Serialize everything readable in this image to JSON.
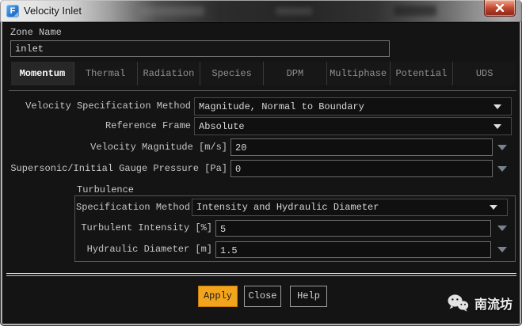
{
  "window": {
    "title": "Velocity Inlet",
    "icon_letter": "F"
  },
  "zone": {
    "label": "Zone Name",
    "value": "inlet"
  },
  "tabs": [
    {
      "label": "Momentum",
      "active": true
    },
    {
      "label": "Thermal",
      "active": false
    },
    {
      "label": "Radiation",
      "active": false
    },
    {
      "label": "Species",
      "active": false
    },
    {
      "label": "DPM",
      "active": false
    },
    {
      "label": "Multiphase",
      "active": false
    },
    {
      "label": "Potential",
      "active": false
    },
    {
      "label": "UDS",
      "active": false
    }
  ],
  "fields": {
    "velocity_spec": {
      "label": "Velocity Specification Method",
      "value": "Magnitude, Normal to Boundary"
    },
    "reference_frame": {
      "label": "Reference Frame",
      "value": "Absolute"
    },
    "velocity_magnitude": {
      "label": "Velocity Magnitude [m/s]",
      "value": "20"
    },
    "supersonic_pressure": {
      "label": "Supersonic/Initial Gauge Pressure [Pa]",
      "value": "0"
    }
  },
  "turbulence": {
    "title": "Turbulence",
    "spec_method": {
      "label": "Specification Method",
      "value": "Intensity and Hydraulic Diameter"
    },
    "intensity": {
      "label": "Turbulent Intensity [%]",
      "value": "5"
    },
    "hydraulic_diameter": {
      "label": "Hydraulic Diameter [m]",
      "value": "1.5"
    }
  },
  "buttons": {
    "apply": "Apply",
    "close": "Close",
    "help": "Help"
  },
  "watermark": {
    "text": "南流坊"
  },
  "colors": {
    "dialog_bg": "#141414",
    "apply_bg": "#F2A51C",
    "close_button_red": "#C24C31",
    "icon_blue": "#2B7CD3",
    "active_tab_bg": "#272727"
  }
}
